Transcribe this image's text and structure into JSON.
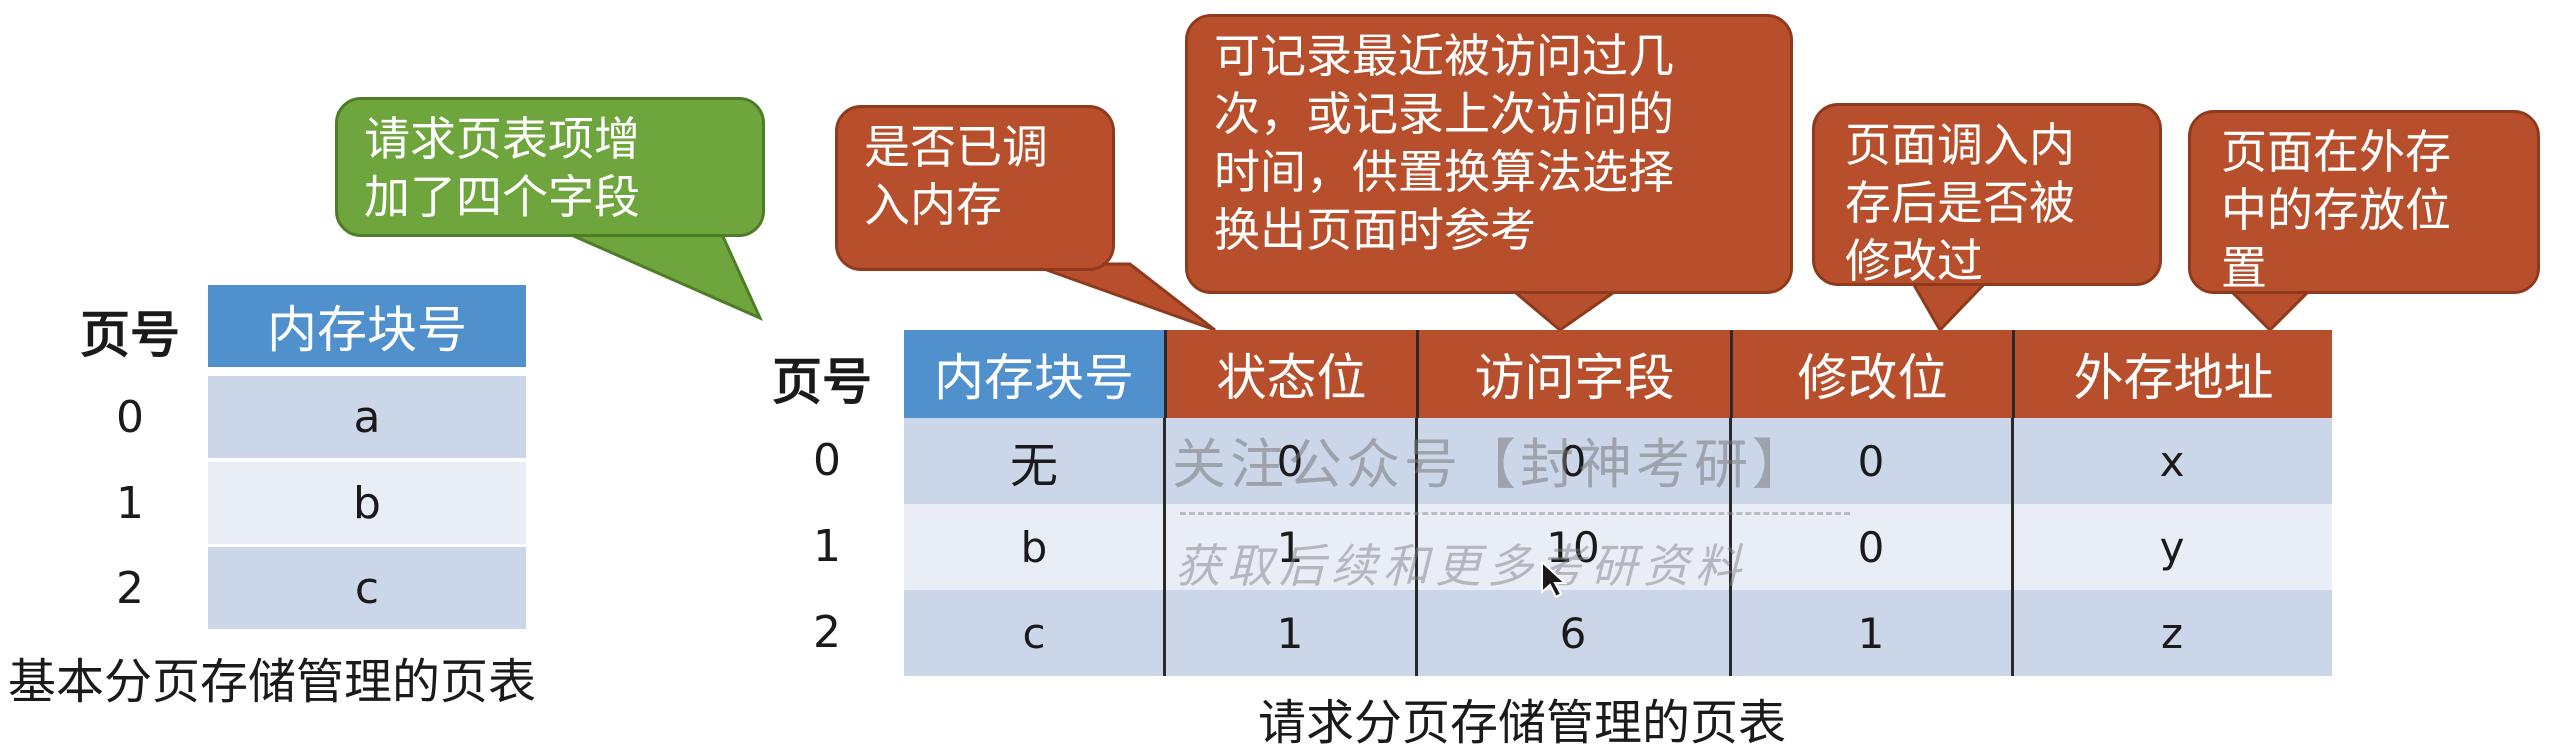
{
  "basic_table": {
    "page_no_header": "页号",
    "frame_header": "内存块号",
    "rows": [
      {
        "page": "0",
        "frame": "a"
      },
      {
        "page": "1",
        "frame": "b"
      },
      {
        "page": "2",
        "frame": "c"
      }
    ],
    "caption": "基本分页存储管理的页表"
  },
  "demand_table": {
    "page_no_header": "页号",
    "columns": [
      "内存块号",
      "状态位",
      "访问字段",
      "修改位",
      "外存地址"
    ],
    "rows": [
      {
        "page": "0",
        "cells": [
          "无",
          "0",
          "0",
          "0",
          "x"
        ]
      },
      {
        "page": "1",
        "cells": [
          "b",
          "1",
          "10",
          "0",
          "y"
        ]
      },
      {
        "page": "2",
        "cells": [
          "c",
          "1",
          "6",
          "1",
          "z"
        ]
      }
    ],
    "caption": "请求分页存储管理的页表"
  },
  "callouts": {
    "green": [
      "请求页表项增",
      "加了四个字段"
    ],
    "status": [
      "是否已调",
      "入内存"
    ],
    "access": [
      "可记录最近被访问过几",
      "次，或记录上次访问的",
      "时间，供置换算法选择",
      "换出页面时参考"
    ],
    "modify": [
      "页面调入内",
      "存后是否被",
      "修改过"
    ],
    "address": [
      "页面在外存",
      "中的存放位",
      "置"
    ]
  },
  "watermark": {
    "line1": "关注公众号【封神考研】",
    "line2": "获取后续和更多考研资料"
  },
  "colors": {
    "blue_header": "#4f90cd",
    "orange": "#b84f2c",
    "green": "#6ea53c",
    "row_dark": "#cbd6e9",
    "row_light": "#e8edf6"
  }
}
